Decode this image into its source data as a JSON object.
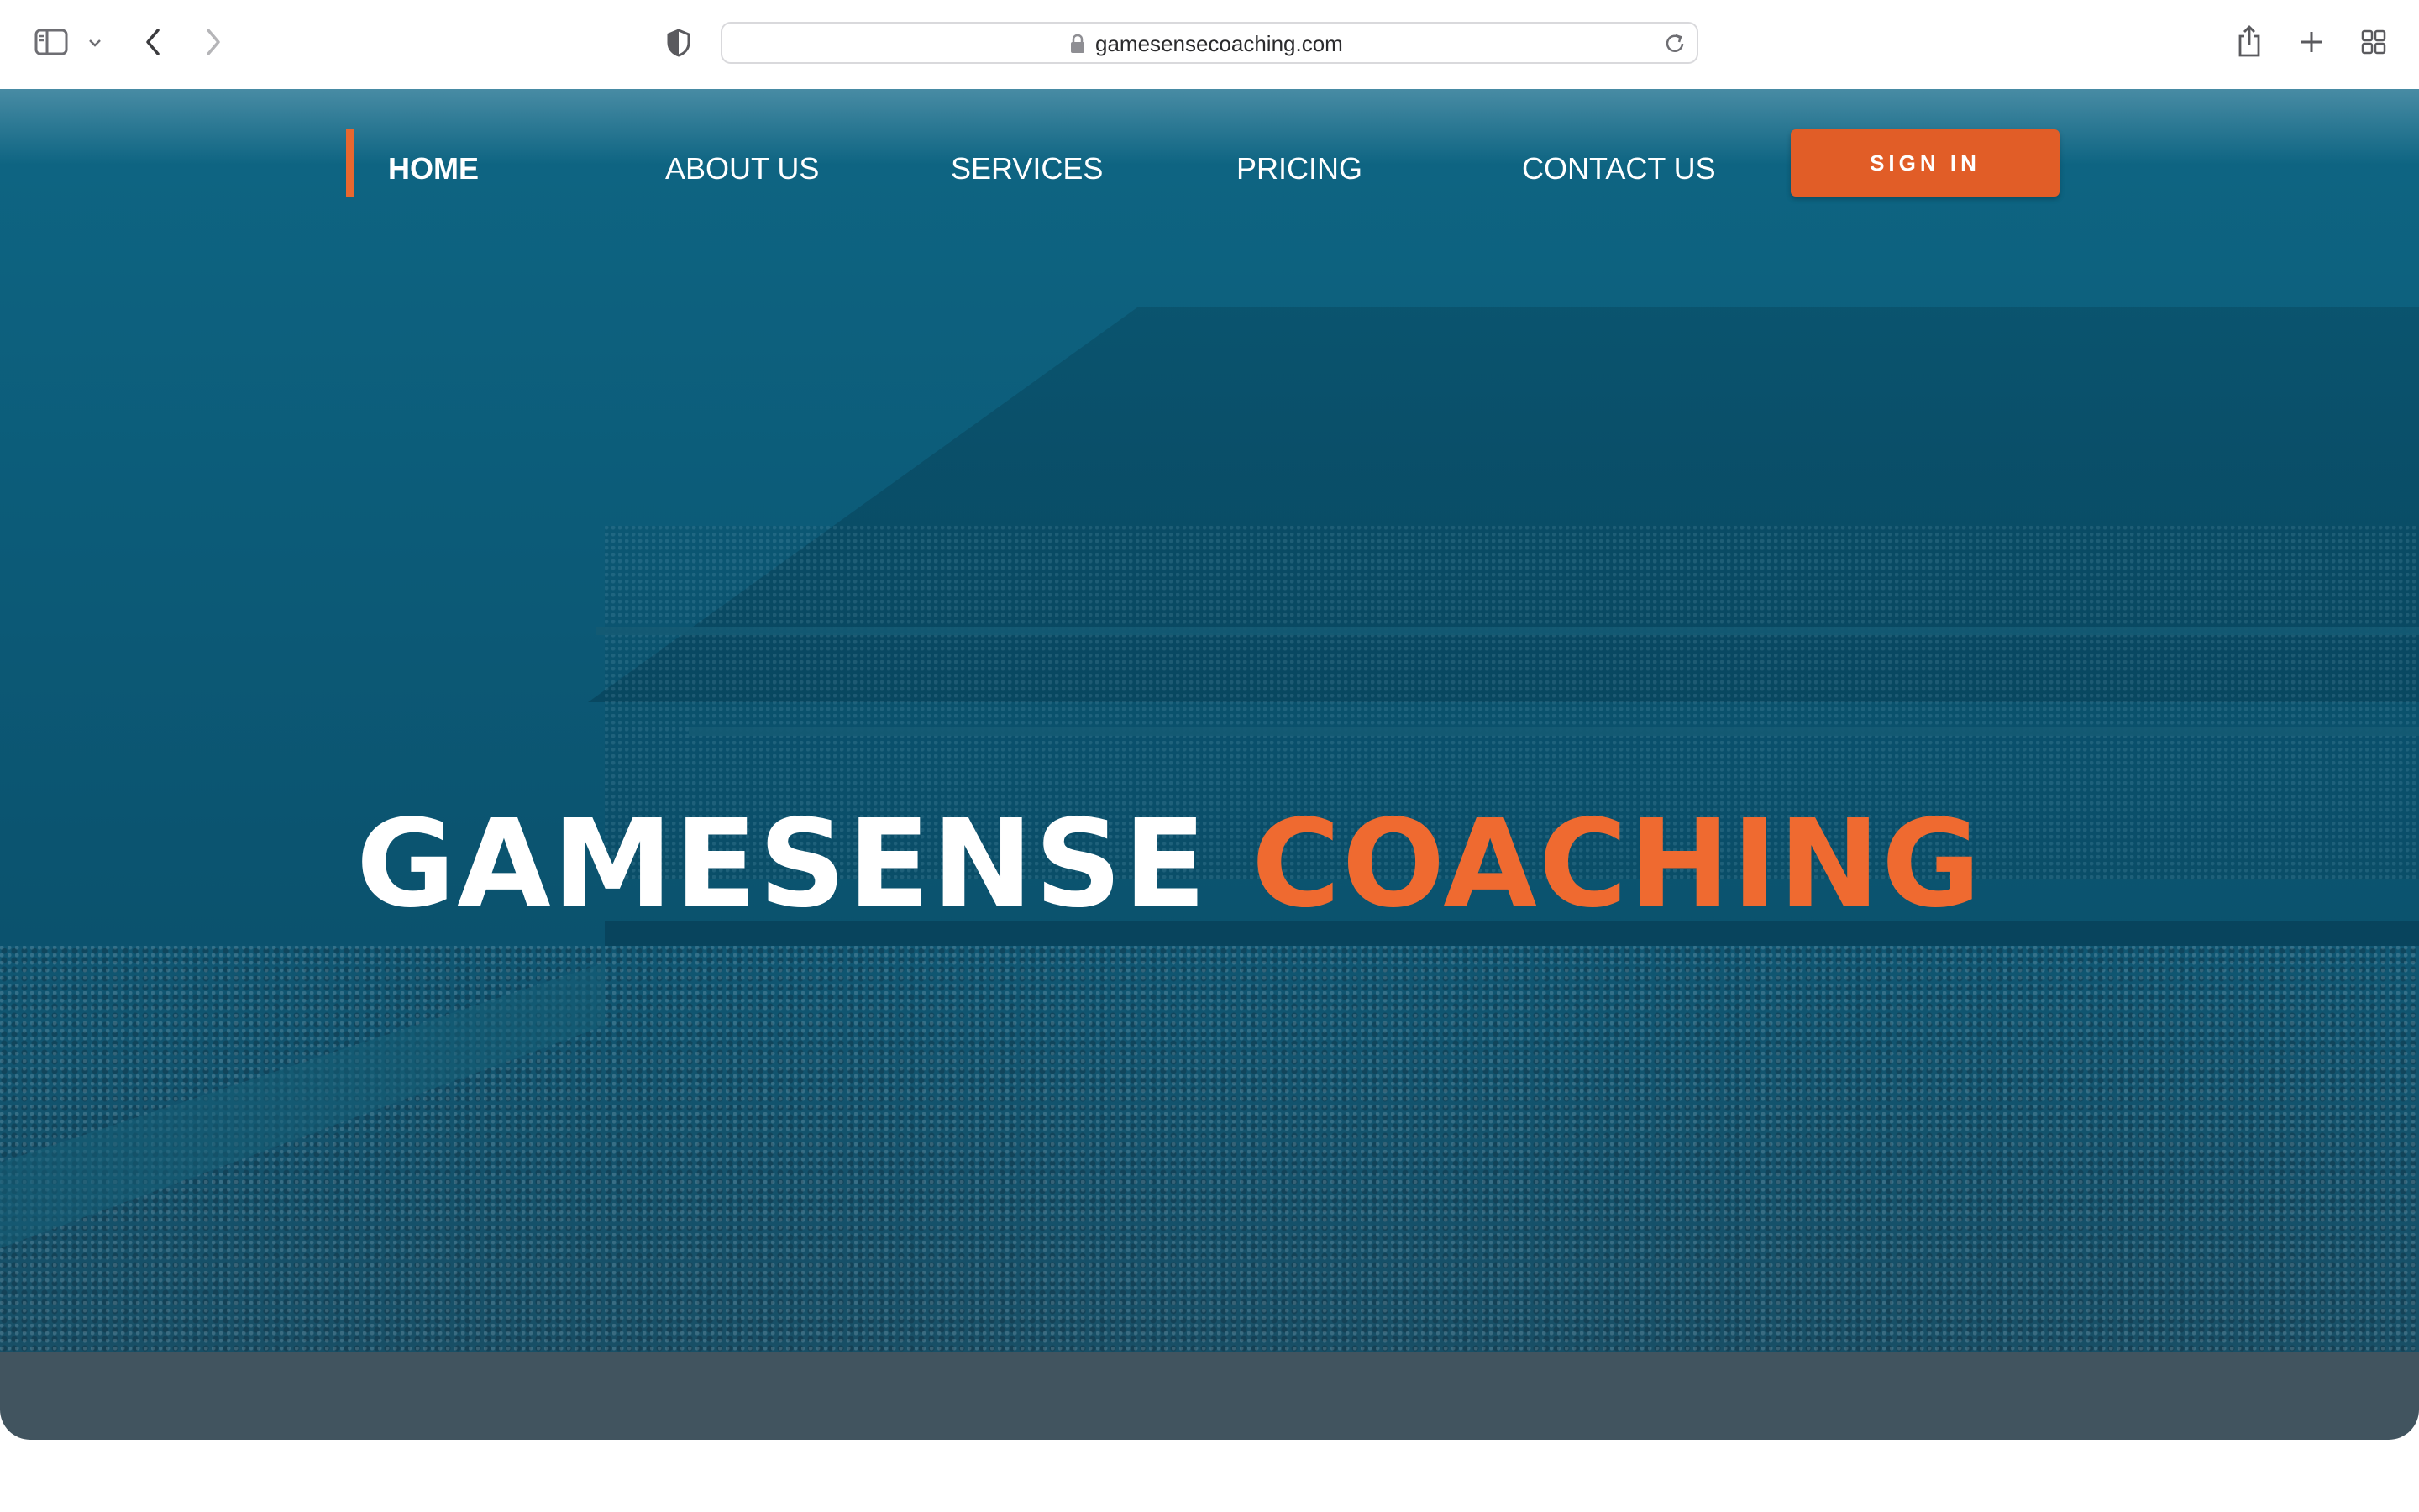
{
  "browser": {
    "url": "gamesensecoaching.com",
    "icons": {
      "sidebar": "sidebar-icon",
      "tab_menu": "chevron-down-icon",
      "back": "chevron-left-icon",
      "forward": "chevron-right-icon",
      "privacy": "shield-icon",
      "lock": "lock-icon",
      "reload": "reload-icon",
      "share": "share-icon",
      "new_tab": "plus-icon",
      "tab_overview": "grid-icon"
    }
  },
  "nav": {
    "items": [
      {
        "label": "HOME",
        "active": true
      },
      {
        "label": "ABOUT US",
        "active": false
      },
      {
        "label": "SERVICES",
        "active": false
      },
      {
        "label": "PRICING",
        "active": false
      },
      {
        "label": "CONTACT US",
        "active": false
      }
    ],
    "sign_in_label": "SIGN IN"
  },
  "hero": {
    "title_primary": "GAMESENSE",
    "title_accent": "COACHING"
  },
  "colors": {
    "accent": "#e15d27",
    "hero_overlay": "#0c5b78",
    "footer_band": "#41545f"
  }
}
